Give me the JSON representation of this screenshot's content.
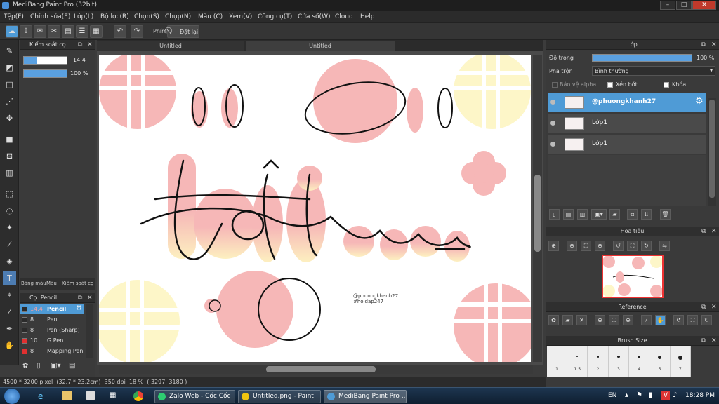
{
  "window": {
    "title": "MediBang Paint Pro (32bit)"
  },
  "menu": [
    "Tệp(F)",
    "Chỉnh sửa(E)",
    "Lớp(L)",
    "Bộ lọc(R)",
    "Chọn(S)",
    "Chụp(N)",
    "Màu (C)",
    "Xem(V)",
    "Công cụ(T)",
    "Cửa sổ(W)",
    "Cloud",
    "Help"
  ],
  "toolbar": {
    "label_phim": "Phím",
    "reset_label": "Đặt lại"
  },
  "brush_control": {
    "title": "Kiểm soát cọ",
    "size_value": "14.4",
    "opacity_value": "100 %"
  },
  "left_tabs": [
    "Bảng màu",
    "Màu",
    "Kiểm soát cọ"
  ],
  "brush_list": {
    "title": "Cọ: Pencil",
    "items": [
      {
        "size": "14.4",
        "name": "Pencil",
        "color": "#2b2b2b"
      },
      {
        "size": "8",
        "name": "Pen",
        "color": "#2b2b2b"
      },
      {
        "size": "8",
        "name": "Pen (Sharp)",
        "color": "#2b2b2b"
      },
      {
        "size": "10",
        "name": "G Pen",
        "color": "#e03030"
      },
      {
        "size": "8",
        "name": "Mapping Pen",
        "color": "#e03030"
      }
    ]
  },
  "tabs": [
    "Untitled",
    "Untitled"
  ],
  "canvas": {
    "watermark_line1": "@phuongkhanh27",
    "watermark_line2": "#hoidap247"
  },
  "layer_panel": {
    "title": "Lớp",
    "opacity_label": "Độ trong",
    "opacity_value": "100 %",
    "opacity_fraction": 1.0,
    "blend_label": "Pha trộn",
    "blend_value": "Bình thường",
    "protect_alpha": "Bảo vệ alpha",
    "clipping": "Xén bớt",
    "lock": "Khóa",
    "layers": [
      {
        "name": "@phuongkhanh27",
        "selected": true
      },
      {
        "name": "Lớp1",
        "selected": false
      },
      {
        "name": "Lớp1",
        "selected": false
      }
    ]
  },
  "navigator": {
    "title": "Hoa tiêu"
  },
  "reference": {
    "title": "Reference"
  },
  "brush_size": {
    "title": "Brush Size",
    "sizes": [
      "1",
      "1.5",
      "2",
      "3",
      "4",
      "5",
      "7"
    ]
  },
  "status": {
    "text": "4500 * 3200 pixel  (32.7 * 23.2cm)  350 dpi  18 %  ( 3297, 3180 )"
  },
  "taskbar": {
    "apps": [
      "Zalo Web - Cốc Cốc",
      "Untitled.png - Paint",
      "MediBang Paint Pro ..."
    ],
    "lang": "EN",
    "time": "18:28 PM"
  },
  "colors": {
    "accent": "#4f9bd6",
    "pink": "#f6b7b7",
    "yellow": "#fdf6c8"
  }
}
